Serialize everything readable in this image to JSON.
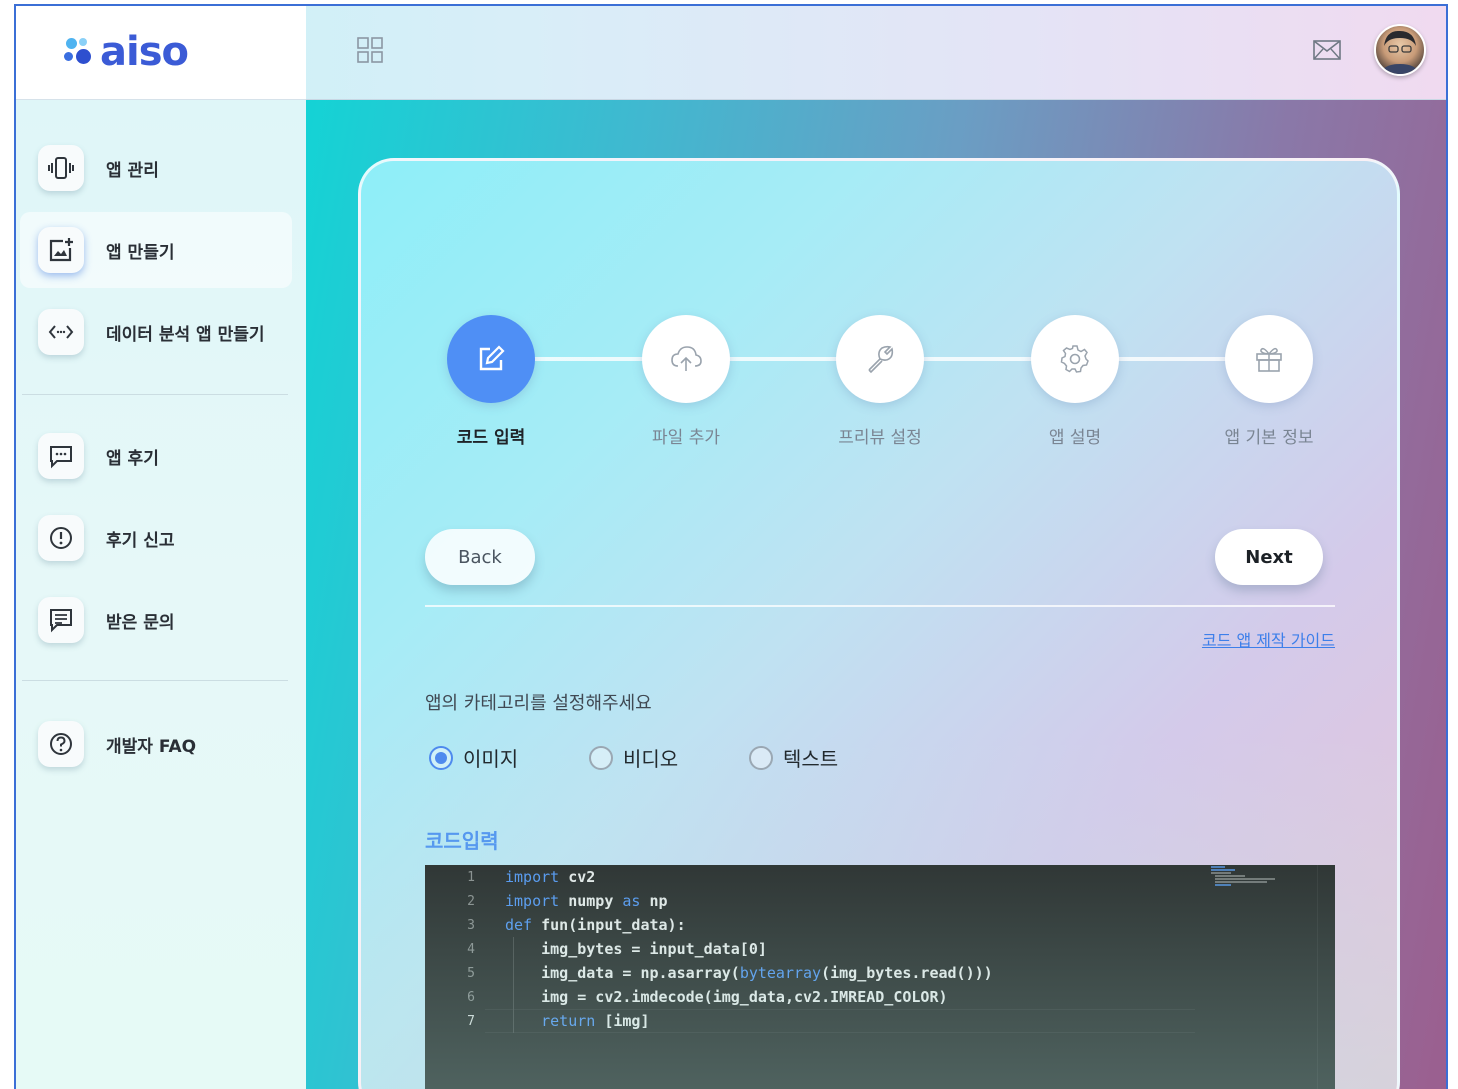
{
  "app": {
    "logo_text": "aiso"
  },
  "header": {
    "grid_icon": "grid-icon",
    "mail_icon": "mail-icon",
    "avatar": "user-avatar"
  },
  "sidebar": {
    "items": [
      {
        "label": "앱 관리",
        "icon": "vibrate-icon"
      },
      {
        "label": "앱 만들기",
        "icon": "add-image-icon",
        "active": true
      },
      {
        "label": "데이터 분석 앱 만들기",
        "icon": "code-icon"
      },
      {
        "label": "앱 후기",
        "icon": "chat-dots-icon"
      },
      {
        "label": "후기 신고",
        "icon": "alert-circle-icon"
      },
      {
        "label": "받은 문의",
        "icon": "message-lines-icon"
      },
      {
        "label": "개발자 FAQ",
        "icon": "help-circle-icon"
      }
    ]
  },
  "stepper": {
    "steps": [
      {
        "label": "코드 입력",
        "icon": "edit-icon",
        "active": true
      },
      {
        "label": "파일 추가",
        "icon": "cloud-upload-icon"
      },
      {
        "label": "프리뷰 설정",
        "icon": "wrench-icon"
      },
      {
        "label": "앱 설명",
        "icon": "settings-icon"
      },
      {
        "label": "앱 기본 정보",
        "icon": "gift-icon"
      }
    ]
  },
  "actions": {
    "back_label": "Back",
    "next_label": "Next"
  },
  "guide_link": "코드 앱 제작 가이드",
  "category": {
    "prompt": "앱의 카테고리를 설정해주세요",
    "options": [
      "이미지",
      "비디오",
      "텍스트"
    ],
    "selected": "이미지"
  },
  "code_section": {
    "title": "코드입력",
    "lines": [
      {
        "n": "1",
        "text": "import cv2"
      },
      {
        "n": "2",
        "text": "import numpy as np"
      },
      {
        "n": "3",
        "text": "def fun(input_data):"
      },
      {
        "n": "4",
        "text": "    img_bytes = input_data[0]"
      },
      {
        "n": "5",
        "text": "    img_data = np.asarray(bytearray(img_bytes.read()))"
      },
      {
        "n": "6",
        "text": "    img = cv2.imdecode(img_data,cv2.IMREAD_COLOR)"
      },
      {
        "n": "7",
        "text": "    return [img]"
      }
    ]
  },
  "colors": {
    "accent": "#4f8ff5",
    "logo": "#3b5bd6",
    "link": "#3d7fea",
    "editor_bg": "#1e1e1e"
  }
}
